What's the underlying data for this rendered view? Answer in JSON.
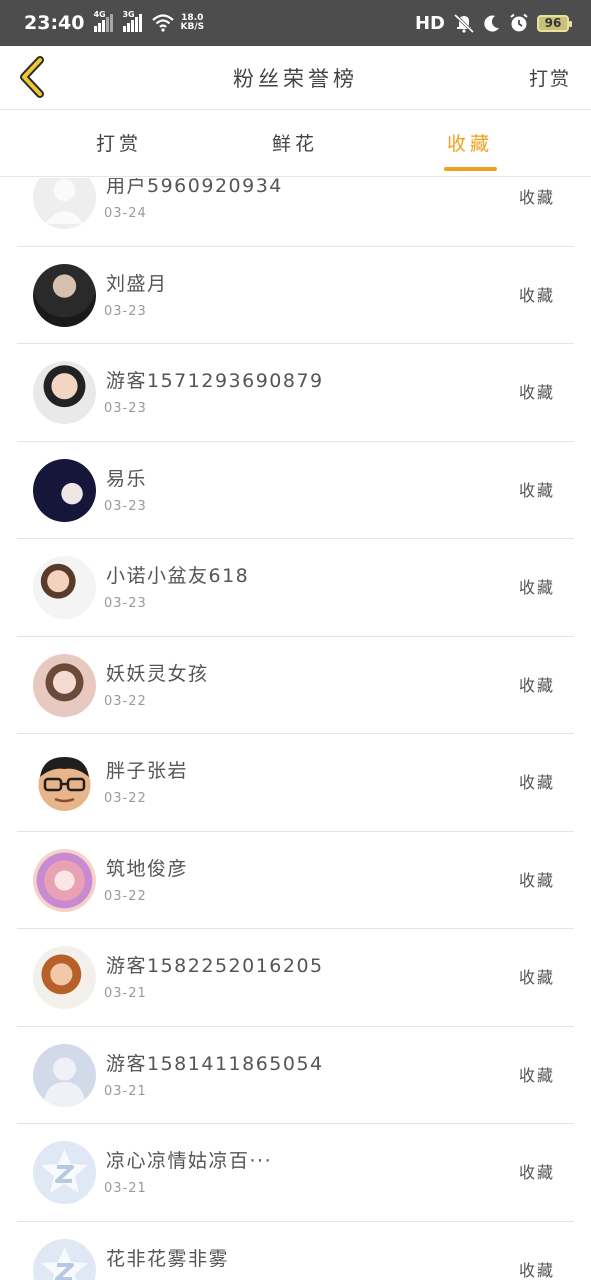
{
  "status_bar": {
    "time": "23:40",
    "sim1_tag": "4G",
    "sim2_tag": "3G",
    "speed_value": "18.0",
    "speed_unit": "KB/S",
    "hd_label": "HD",
    "battery": "96"
  },
  "header": {
    "title": "粉丝荣誉榜",
    "action_label": "打赏"
  },
  "tabs": [
    {
      "label": "打赏",
      "active": false
    },
    {
      "label": "鲜花",
      "active": false
    },
    {
      "label": "收藏",
      "active": true
    }
  ],
  "accent_color": "#f0a21f",
  "list": [
    {
      "name": "用户5960920934",
      "date": "03-24",
      "action": "收藏",
      "avatar": "default-person-light"
    },
    {
      "name": "刘盛月",
      "date": "03-23",
      "action": "收藏",
      "avatar": "photo"
    },
    {
      "name": "游客1571293690879",
      "date": "03-23",
      "action": "收藏",
      "avatar": "photo"
    },
    {
      "name": "易乐",
      "date": "03-23",
      "action": "收藏",
      "avatar": "photo"
    },
    {
      "name": "小诺小盆友618",
      "date": "03-23",
      "action": "收藏",
      "avatar": "photo"
    },
    {
      "name": "妖妖灵女孩",
      "date": "03-22",
      "action": "收藏",
      "avatar": "photo"
    },
    {
      "name": "胖子张岩",
      "date": "03-22",
      "action": "收藏",
      "avatar": "photo"
    },
    {
      "name": "筑地俊彦",
      "date": "03-22",
      "action": "收藏",
      "avatar": "anime"
    },
    {
      "name": "游客1582252016205",
      "date": "03-21",
      "action": "收藏",
      "avatar": "photo"
    },
    {
      "name": "游客1581411865054",
      "date": "03-21",
      "action": "收藏",
      "avatar": "default-person"
    },
    {
      "name": "凉心凉情姑凉百···",
      "date": "03-21",
      "action": "收藏",
      "avatar": "z-logo"
    },
    {
      "name": "花非花雾非雾",
      "date": "",
      "action": "收藏",
      "avatar": "z-logo"
    }
  ]
}
